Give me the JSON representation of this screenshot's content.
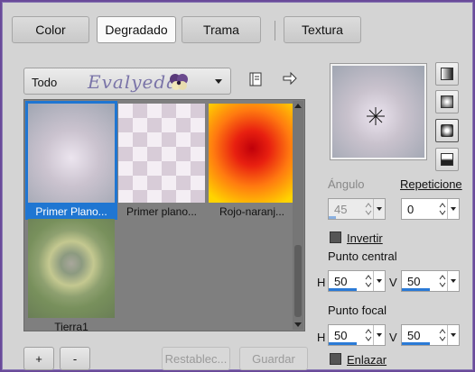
{
  "tabs": [
    {
      "label": "Color"
    },
    {
      "label": "Degradado",
      "active": true
    },
    {
      "label": "Trama"
    },
    {
      "label": "Textura"
    }
  ],
  "library": {
    "category": "Todo",
    "logo_text": "Evalyeda",
    "items": [
      {
        "label": "Primer Plano...",
        "selected": true
      },
      {
        "label": "Primer plano..."
      },
      {
        "label": "Rojo-naranj..."
      },
      {
        "label": "Tierra1"
      }
    ]
  },
  "buttons": {
    "add": "+",
    "remove": "-",
    "restore": "Restablec...",
    "save": "Guardar"
  },
  "settings": {
    "angle_label": "Ángulo",
    "angle_value": "45",
    "repeat_label": "Repeticione",
    "repeat_value": "0",
    "invert_label": "Invertir",
    "center_label": "Punto central",
    "center_h_label": "H",
    "center_h": "50",
    "center_v_label": "V",
    "center_v": "50",
    "focal_label": "Punto focal",
    "focal_h_label": "H",
    "focal_h": "50",
    "focal_v_label": "V",
    "focal_v": "50",
    "link_label": "Enlazar"
  },
  "colors": {
    "accent": "#1f76d2",
    "window_bg": "#d4d4d4",
    "grid_bg": "#7f7f7f"
  }
}
